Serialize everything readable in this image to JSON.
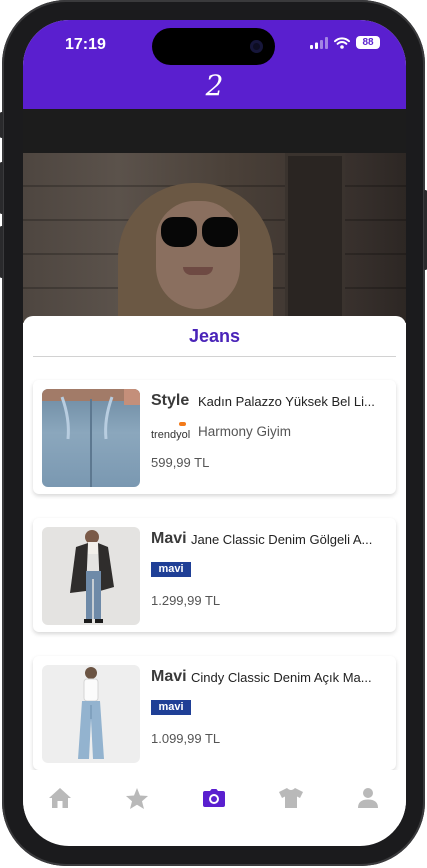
{
  "status_bar": {
    "time": "17:19",
    "battery": "88"
  },
  "header": {
    "logo": "2"
  },
  "sheet": {
    "title": "Jeans"
  },
  "products": [
    {
      "brand": "Style",
      "name": "Kadın Palazzo Yüksek Bel Li...",
      "store_logo": "trendyol",
      "store_name": "Harmony Giyim",
      "price": "599,99 TL"
    },
    {
      "brand": "Mavi",
      "name": "Jane Classic Denim Gölgeli A...",
      "store_logo": "mavi",
      "store_name": "",
      "price": "1.299,99 TL"
    },
    {
      "brand": "Mavi",
      "name": "Cindy Classic Denim Açık Ma...",
      "store_logo": "mavi",
      "store_name": "",
      "price": "1.099,99 TL"
    }
  ],
  "tabbar": {
    "items": [
      {
        "icon": "home-icon",
        "active": false
      },
      {
        "icon": "star-icon",
        "active": false
      },
      {
        "icon": "camera-icon",
        "active": true
      },
      {
        "icon": "shirt-icon",
        "active": false
      },
      {
        "icon": "person-icon",
        "active": false
      }
    ]
  },
  "colors": {
    "accent": "#5a1fcf",
    "title": "#4a24b8",
    "inactive_icon": "#b9b9b9",
    "mavi_blue": "#1f3f96",
    "trendyol_orange": "#f27a1a"
  }
}
